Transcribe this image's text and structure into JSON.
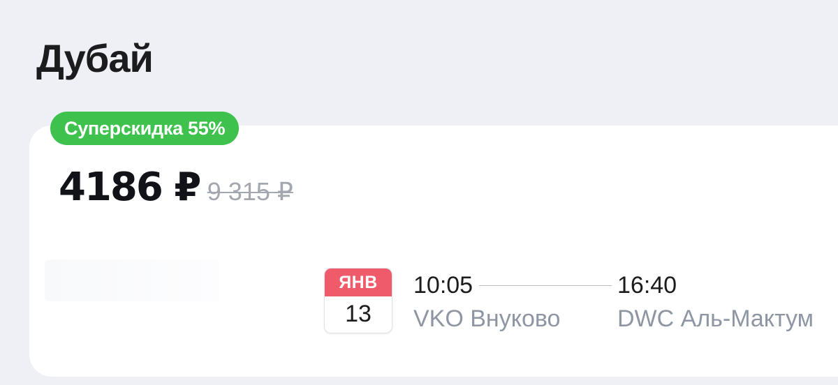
{
  "page": {
    "title": "Дубай"
  },
  "offer": {
    "badge": "Суперскидка 55%",
    "price_current": "4186 ₽",
    "price_old": "9 315 ₽"
  },
  "flight": {
    "date": {
      "month": "ЯНВ",
      "day": "13"
    },
    "departure": {
      "time": "10:05",
      "airport": "VKO Внуково"
    },
    "arrival": {
      "time": "16:40",
      "airport": "DWC Аль-Мактум"
    }
  },
  "colors": {
    "background": "#eef0f5",
    "badge_green": "#3ec24d",
    "calendar_red": "#f05b6b",
    "muted_text": "#8f96a3"
  }
}
